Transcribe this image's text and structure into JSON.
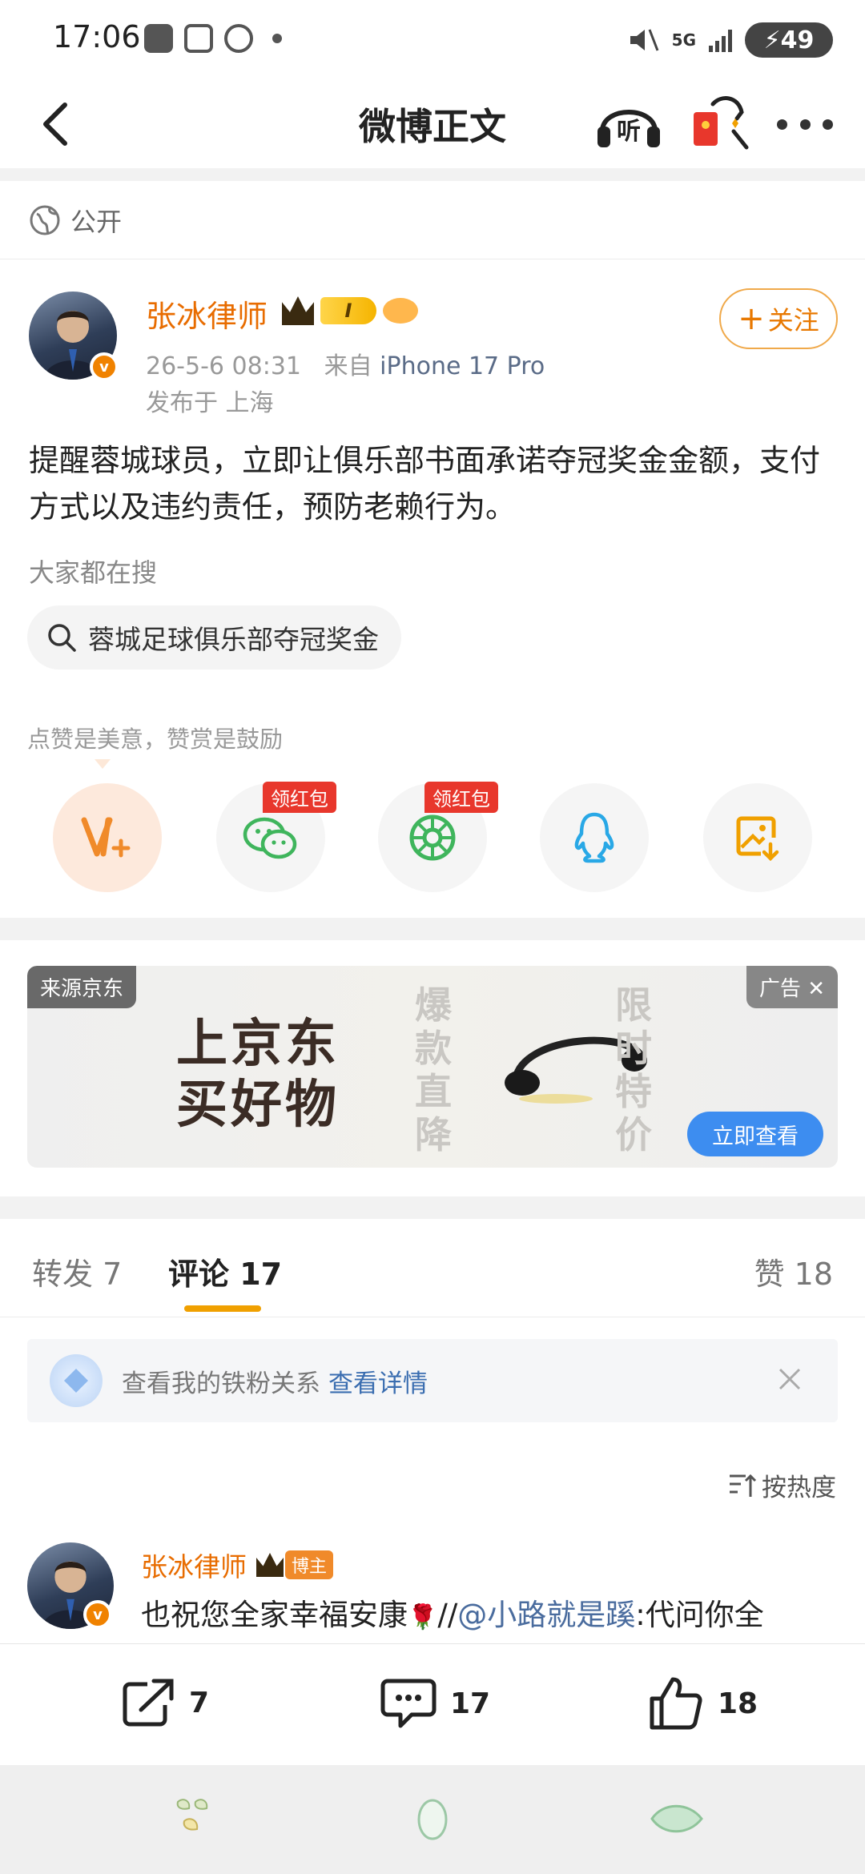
{
  "status_bar": {
    "time": "17:06",
    "battery": "49",
    "network": "5G"
  },
  "nav": {
    "title": "微博正文",
    "listen_label": "听"
  },
  "post": {
    "visibility": "公开",
    "author": "张冰律师",
    "level_badge": "I",
    "verified_mark": "v",
    "time": "26-5-6 08:31",
    "source_prefix": "来自",
    "device": "iPhone 17 Pro",
    "location": "发布于 上海",
    "follow_label": "关注",
    "text": "提醒蓉城球员，立即让俱乐部书面承诺夺冠奖金金额，支付方式以及违约责任，预防老赖行为。",
    "search_title": "大家都在搜",
    "search_query": "蓉城足球俱乐部夺冠奖金",
    "reward_hint": "点赞是美意，赞赏是鼓励",
    "hongbao_tag": "领红包",
    "share_icons": [
      "weibo-reward-icon",
      "wechat-icon",
      "moments-icon",
      "qq-icon",
      "save-image-icon"
    ]
  },
  "ad": {
    "source": "来源京东",
    "tag": "广告",
    "headline_line1": "上京东",
    "headline_line2": "买好物",
    "vertical_left": "爆款直降",
    "vertical_right": "限时特价",
    "cta": "立即查看"
  },
  "tabs": {
    "repost": "转发 7",
    "comment": "评论 17",
    "like": "赞 18"
  },
  "ironfan": {
    "text": "查看我的铁粉关系",
    "link": "查看详情"
  },
  "sort_label": "按热度",
  "comment": {
    "author": "张冰律师",
    "badge": "博主",
    "text": "也祝您全家幸福安康",
    "slashes": "//",
    "mention": "@小路就是蹊",
    "tail": ":代问你全"
  },
  "actions": {
    "repost_count": "7",
    "comment_count": "17",
    "like_count": "18"
  },
  "colors": {
    "orange": "#e86c00",
    "link_blue": "#3a6db0",
    "accent_yellow": "#f0a000"
  }
}
